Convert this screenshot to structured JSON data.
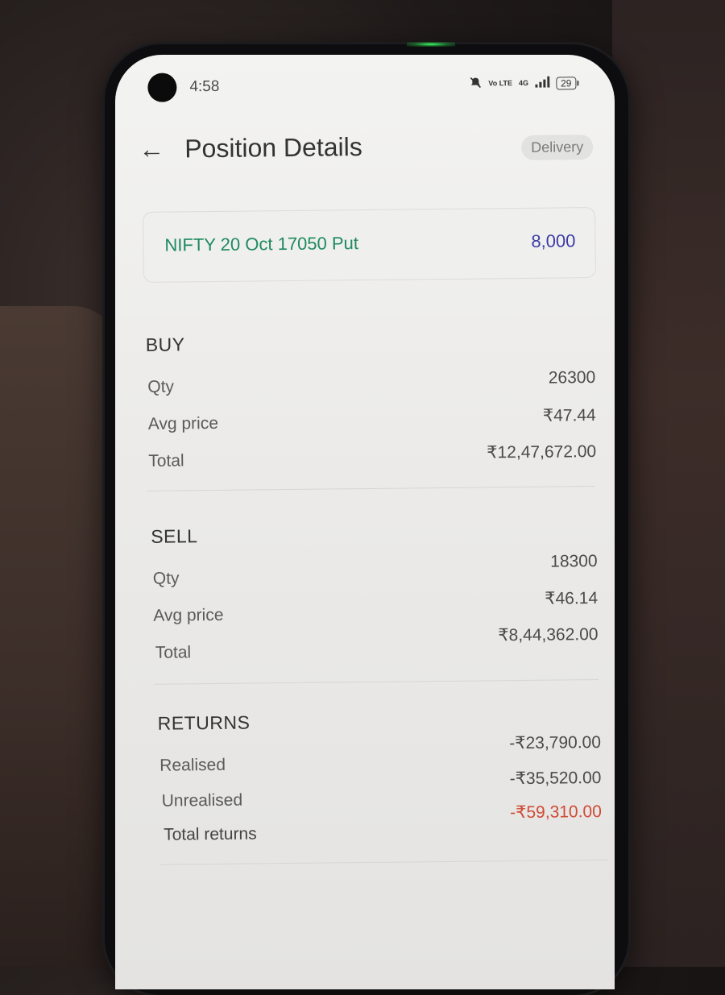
{
  "status_bar": {
    "time": "4:58",
    "network_label": "Vo LTE",
    "network_type": "4G",
    "battery_level": "29",
    "icons": [
      "mute-icon",
      "signal-icon",
      "battery-icon"
    ]
  },
  "header": {
    "title": "Position Details",
    "back_icon": "←",
    "product_chip": "Delivery"
  },
  "instrument_card": {
    "name": "NIFTY 20 Oct 17050 Put",
    "quantity": "8,000"
  },
  "buy": {
    "title": "BUY",
    "rows": [
      {
        "label": "Qty",
        "value": "26300"
      },
      {
        "label": "Avg price",
        "value": "₹47.44"
      },
      {
        "label": "Total",
        "value": "₹12,47,672.00"
      }
    ]
  },
  "sell": {
    "title": "SELL",
    "rows": [
      {
        "label": "Qty",
        "value": "18300"
      },
      {
        "label": "Avg price",
        "value": "₹46.14"
      },
      {
        "label": "Total",
        "value": "₹8,44,362.00"
      }
    ]
  },
  "returns": {
    "title": "RETURNS",
    "rows": [
      {
        "label": "Realised",
        "value": "-₹23,790.00"
      },
      {
        "label": "Unrealised",
        "value": "-₹35,520.00"
      },
      {
        "label": "Total returns",
        "value": "-₹59,310.00"
      }
    ]
  },
  "colors": {
    "instrument_green": "#1e8a5e",
    "quantity_blue": "#3a3aa8",
    "negative_red": "#d04a35"
  }
}
